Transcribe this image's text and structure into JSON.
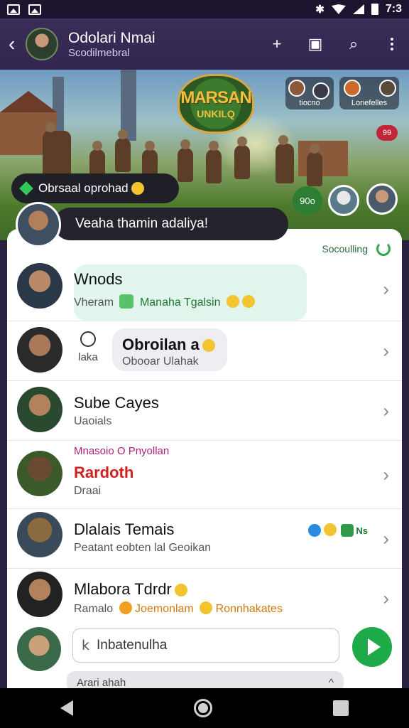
{
  "status_bar": {
    "time": "7:3"
  },
  "header": {
    "back_icon": "chevron-left-icon",
    "title": "Odolari Nmai",
    "subtitle": "Scodilmebral",
    "actions": [
      "add-icon",
      "chat-icon",
      "search-icon",
      "more-vert-icon"
    ]
  },
  "banner": {
    "logo_line1": "MARSAN",
    "logo_line2": "UNKILQ",
    "chip1_label": "tiocno",
    "chip2_label": "Lonefelles",
    "red_badge": "99",
    "green_pill": "90o",
    "pinned_text": "Obrsaal oprohad",
    "floating_message": "Veaha thamin adaliya!"
  },
  "chat_list": {
    "sort_label": "Socoulling",
    "rows": [
      {
        "name": "Wnods",
        "preview_a": "Vheram",
        "preview_b": "Manaha Tgalsin"
      },
      {
        "name": "Obroilan a",
        "preview": "Obooar Ulahak",
        "side_label": "laka"
      },
      {
        "name": "Sube Cayes",
        "preview": "Uaoials"
      },
      {
        "label_top": "Mnasoio O Pnyollan",
        "name": "Rardoth",
        "preview": "Draai"
      },
      {
        "name": "Dlalais Temais",
        "preview": "Peatant  eobten lal Geoikan",
        "badge": "Ns"
      },
      {
        "name": "Mlabora Tdrdr",
        "preview_a": "Ramalo",
        "preview_b": "Joemonlam",
        "preview_c": "Ronnhakates"
      }
    ]
  },
  "compose": {
    "placeholder": "Inbatenulha",
    "strip_left": "Arari ahah",
    "strip_right": "^"
  },
  "colors": {
    "accent": "#1faa4a",
    "header_bg": "#3a2e58"
  }
}
